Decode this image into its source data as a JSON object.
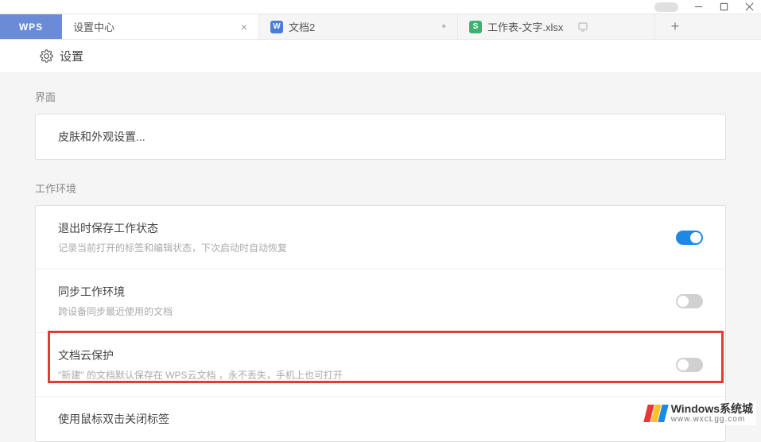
{
  "titlebar": {
    "minimize": "minimize",
    "maximize": "maximize",
    "close": "close"
  },
  "tabs": {
    "brand": "WPS",
    "t1": "设置中心",
    "t2": "文档2",
    "t3": "工作表-文字.xlsx",
    "new": "+"
  },
  "page": {
    "title": "设置"
  },
  "sections": {
    "ui": {
      "label": "界面",
      "skin": "皮肤和外观设置..."
    },
    "work": {
      "label": "工作环境",
      "save_state": {
        "title": "退出时保存工作状态",
        "desc": "记录当前打开的标签和编辑状态，下次启动时自动恢复",
        "on": true
      },
      "sync": {
        "title": "同步工作环境",
        "desc": "跨设备同步最近使用的文档",
        "on": false
      },
      "cloud": {
        "title": "文档云保护",
        "desc": "\"新建\" 的文档默认保存在 WPS云文档 ，永不丢失，手机上也可打开",
        "on": false
      },
      "dblclick": {
        "title": "使用鼠标双击关闭标签"
      }
    }
  },
  "watermark": {
    "line1": "Windows系统城",
    "line2": "www.wxcLgg.com"
  }
}
